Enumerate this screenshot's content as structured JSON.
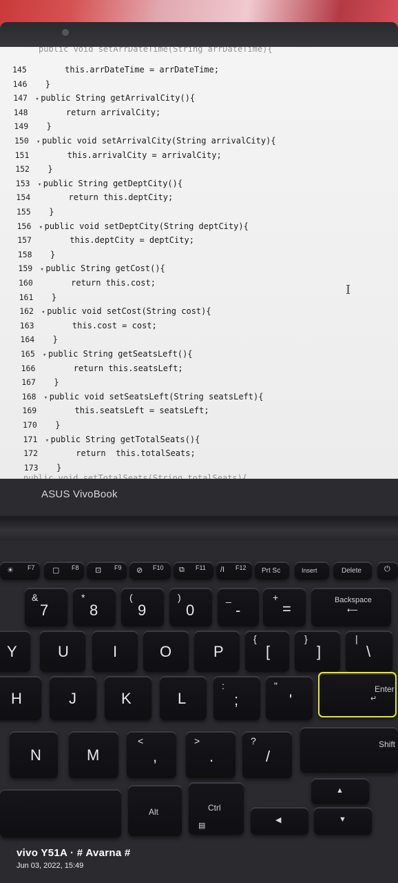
{
  "editor": {
    "top_partial": "public void setArrDateTime(String arrDateTime){",
    "bottom_partial": "public void setTotalSeats(String totalSeats){",
    "lines": [
      {
        "num": "145",
        "fold": "",
        "code": "     this.arrDateTime = arrDateTime;"
      },
      {
        "num": "146",
        "fold": "",
        "code": " }"
      },
      {
        "num": "147",
        "fold": "▾",
        "code": "public String getArrivalCity(){"
      },
      {
        "num": "148",
        "fold": "",
        "code": "     return arrivalCity;"
      },
      {
        "num": "149",
        "fold": "",
        "code": " }"
      },
      {
        "num": "150",
        "fold": "▾",
        "code": "public void setArrivalCity(String arrivalCity){"
      },
      {
        "num": "151",
        "fold": "",
        "code": "     this.arrivalCity = arrivalCity;"
      },
      {
        "num": "152",
        "fold": "",
        "code": " }"
      },
      {
        "num": "153",
        "fold": "▾",
        "code": "public String getDeptCity(){"
      },
      {
        "num": "154",
        "fold": "",
        "code": "     return this.deptCity;"
      },
      {
        "num": "155",
        "fold": "",
        "code": " }"
      },
      {
        "num": "156",
        "fold": "▾",
        "code": "public void setDeptCity(String deptCity){"
      },
      {
        "num": "157",
        "fold": "",
        "code": "     this.deptCity = deptCity;"
      },
      {
        "num": "158",
        "fold": "",
        "code": " }"
      },
      {
        "num": "159",
        "fold": "▾",
        "code": "public String getCost(){"
      },
      {
        "num": "160",
        "fold": "",
        "code": "     return this.cost;"
      },
      {
        "num": "161",
        "fold": "",
        "code": " }"
      },
      {
        "num": "162",
        "fold": "▾",
        "code": "public void setCost(String cost){"
      },
      {
        "num": "163",
        "fold": "",
        "code": "     this.cost = cost;"
      },
      {
        "num": "164",
        "fold": "",
        "code": " }"
      },
      {
        "num": "165",
        "fold": "▾",
        "code": "public String getSeatsLeft(){"
      },
      {
        "num": "166",
        "fold": "",
        "code": "     return this.seatsLeft;"
      },
      {
        "num": "167",
        "fold": "",
        "code": " }"
      },
      {
        "num": "168",
        "fold": "▾",
        "code": "public void setSeatsLeft(String seatsLeft){"
      },
      {
        "num": "169",
        "fold": "",
        "code": "     this.seatsLeft = seatsLeft;"
      },
      {
        "num": "170",
        "fold": "",
        "code": " }"
      },
      {
        "num": "171",
        "fold": "▾",
        "code": "public String getTotalSeats(){"
      },
      {
        "num": "172",
        "fold": "",
        "code": "     return  this.totalSeats;"
      },
      {
        "num": "173",
        "fold": "",
        "code": " }"
      }
    ]
  },
  "laptop": {
    "brand": "ASUS VivoBook"
  },
  "keys": {
    "f7": "F7",
    "f8": "F8",
    "f9": "F9",
    "f10": "F10",
    "f11": "F11",
    "f12": "F12",
    "prtsc": "Prt Sc",
    "insert": "Insert",
    "delete": "Delete",
    "k7": "7",
    "k7_sub": "&",
    "k8": "8",
    "k8_sub": "*",
    "k9": "9",
    "k9_sub": "(",
    "k0": "0",
    "k0_sub": ")",
    "minus": "-",
    "minus_sub": "_",
    "equals": "=",
    "equals_sub": "+",
    "backspace": "Backspace",
    "y": "Y",
    "u": "U",
    "i": "I",
    "o": "O",
    "p": "P",
    "lbracket": "[",
    "lbracket_sub": "{",
    "rbracket": "]",
    "rbracket_sub": "}",
    "backslash": "\\",
    "backslash_sub": "|",
    "h": "H",
    "j": "J",
    "k": "K",
    "l": "L",
    "semicolon": ";",
    "semicolon_sub": ":",
    "quote": "'",
    "quote_sub": "\"",
    "enter": "Enter",
    "n": "N",
    "m": "M",
    "comma": ",",
    "comma_sub": "<",
    "period": ".",
    "period_sub": ">",
    "slash": "/",
    "slash_sub": "?",
    "shift": "Shift",
    "alt": "Alt",
    "ctrl": "Ctrl",
    "arrow_left": "◀",
    "arrow_up": "▲",
    "arrow_down": "▼"
  },
  "watermark": {
    "title": "vivo Y51A · # Avarna #",
    "date": "Jun 03, 2022, 15:49"
  }
}
